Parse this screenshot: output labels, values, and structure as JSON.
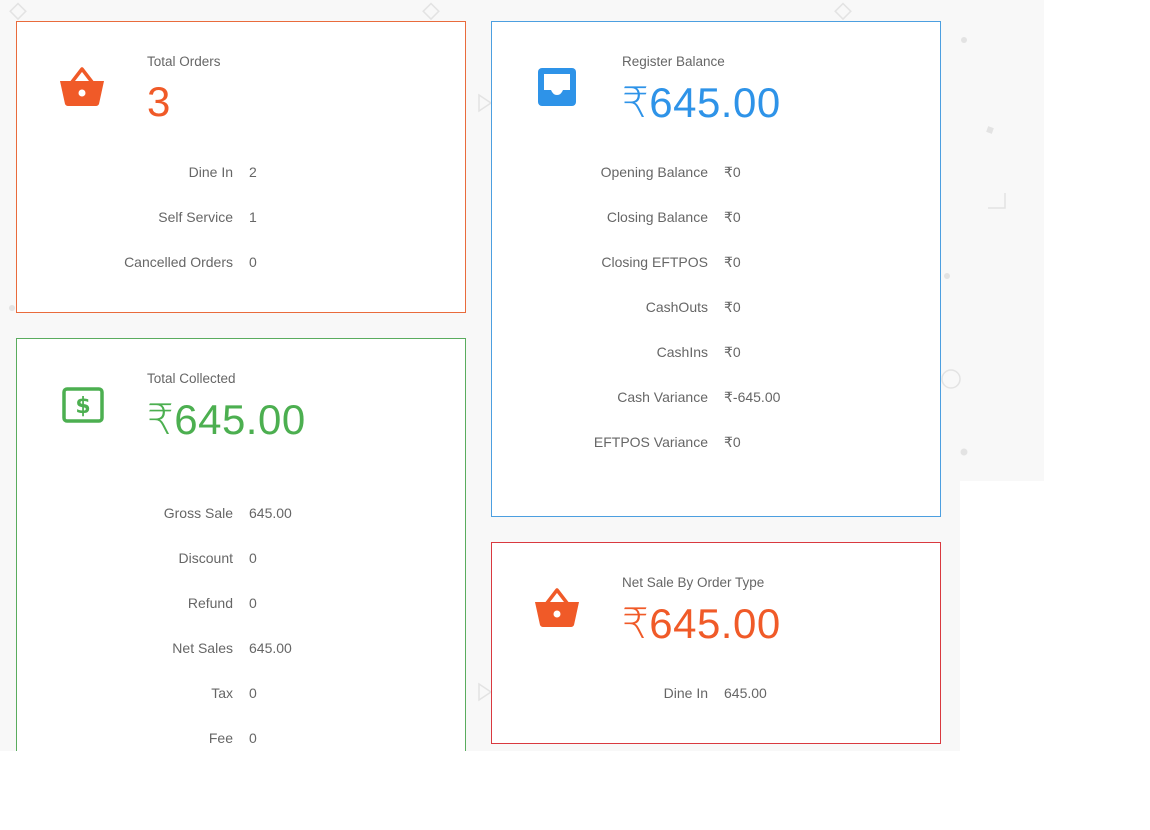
{
  "colors": {
    "orders": "#f05a28",
    "register": "#2e93e8",
    "collected": "#4caf50",
    "netsale": "#f05a28"
  },
  "total_orders": {
    "icon": "basket-icon",
    "title": "Total Orders",
    "value": "3",
    "rows": [
      {
        "label": "Dine In",
        "value": "2"
      },
      {
        "label": "Self Service",
        "value": "1"
      },
      {
        "label": "Cancelled Orders",
        "value": "0"
      }
    ]
  },
  "register_balance": {
    "icon": "inbox-icon",
    "title": "Register Balance",
    "value": "₹645.00",
    "rows": [
      {
        "label": "Opening Balance",
        "value": "₹0"
      },
      {
        "label": "Closing Balance",
        "value": "₹0"
      },
      {
        "label": "Closing EFTPOS",
        "value": "₹0"
      },
      {
        "label": "CashOuts",
        "value": "₹0"
      },
      {
        "label": "CashIns",
        "value": "₹0"
      },
      {
        "label": "Cash Variance",
        "value": "₹-645.00"
      },
      {
        "label": "EFTPOS Variance",
        "value": "₹0"
      }
    ]
  },
  "total_collected": {
    "icon": "dollar-bill-icon",
    "title": "Total Collected",
    "value": "₹645.00",
    "rows": [
      {
        "label": "Gross Sale",
        "value": "645.00"
      },
      {
        "label": "Discount",
        "value": "0"
      },
      {
        "label": "Refund",
        "value": "0"
      },
      {
        "label": "Net Sales",
        "value": "645.00"
      },
      {
        "label": "Tax",
        "value": "0"
      },
      {
        "label": "Fee",
        "value": "0"
      }
    ]
  },
  "net_sale": {
    "icon": "basket-icon",
    "title": "Net Sale By Order Type",
    "value": "₹645.00",
    "rows": [
      {
        "label": "Dine In",
        "value": "645.00"
      }
    ]
  }
}
